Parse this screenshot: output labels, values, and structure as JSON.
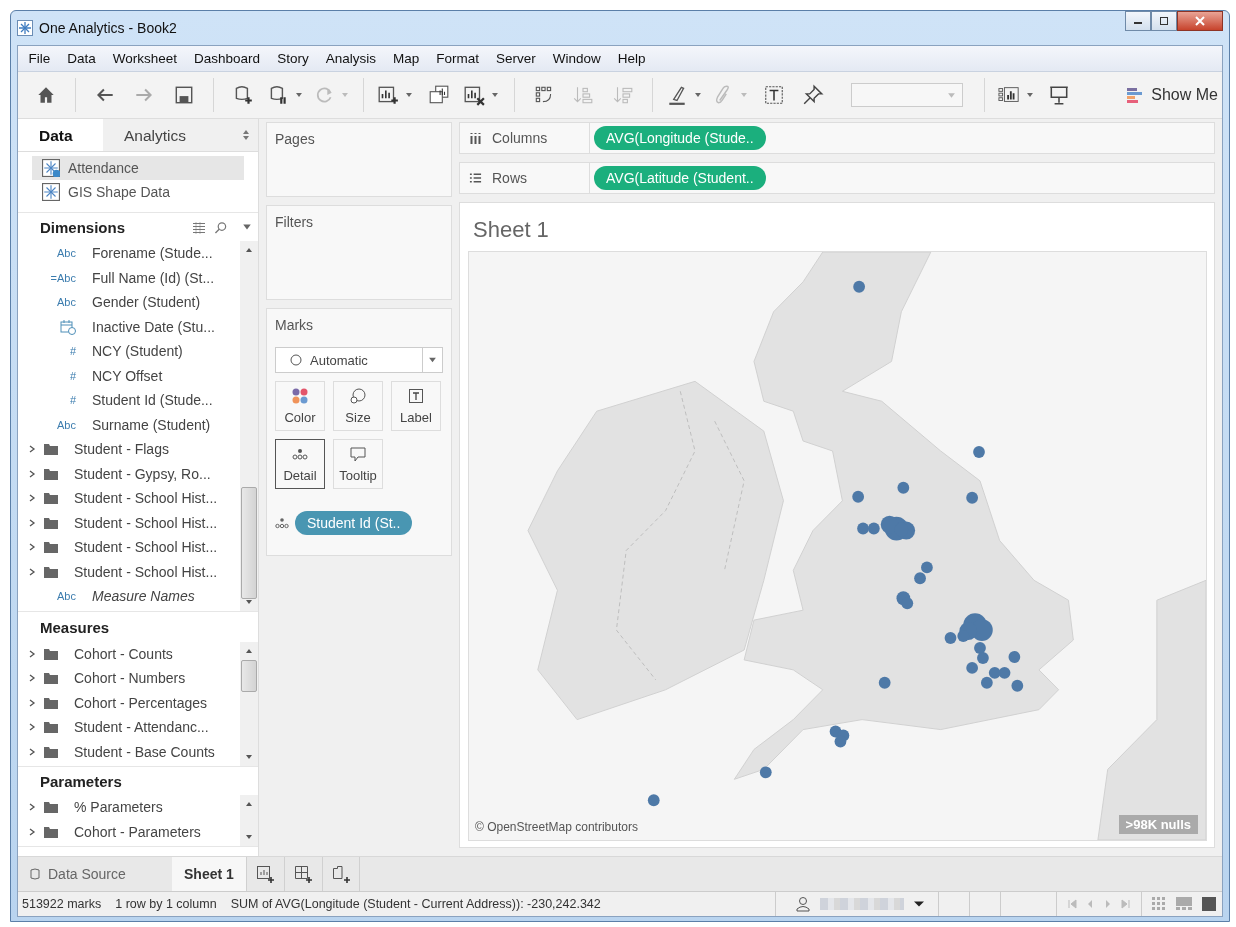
{
  "window": {
    "title": "One Analytics - Book2"
  },
  "menu": [
    "File",
    "Data",
    "Worksheet",
    "Dashboard",
    "Story",
    "Analysis",
    "Map",
    "Format",
    "Server",
    "Window",
    "Help"
  ],
  "toolbar": {
    "show_me": "Show Me"
  },
  "side_tabs": [
    {
      "label": "Data",
      "selected": true
    },
    {
      "label": "Analytics",
      "selected": false
    }
  ],
  "data_sources": [
    {
      "name": "Attendance",
      "selected": true
    },
    {
      "name": "GIS Shape Data",
      "selected": false
    }
  ],
  "dimensions": {
    "title": "Dimensions",
    "items": [
      {
        "kind": "field",
        "type": "Abc",
        "name": "Forename (Stude...",
        "italic": false
      },
      {
        "kind": "field",
        "type": "=Abc",
        "name": "Full Name (Id) (St...",
        "italic": false
      },
      {
        "kind": "field",
        "type": "Abc",
        "name": "Gender (Student)",
        "italic": false
      },
      {
        "kind": "date",
        "name": "Inactive Date (Stu...",
        "italic": false
      },
      {
        "kind": "field",
        "type": "#",
        "name": "NCY (Student)",
        "italic": false
      },
      {
        "kind": "field",
        "type": "#",
        "name": "NCY Offset",
        "italic": false
      },
      {
        "kind": "field",
        "type": "#",
        "name": "Student Id (Stude...",
        "italic": false
      },
      {
        "kind": "field",
        "type": "Abc",
        "name": "Surname (Student)",
        "italic": false
      },
      {
        "kind": "folder",
        "name": "Student - Flags",
        "expanded": false
      },
      {
        "kind": "folder",
        "name": "Student - Gypsy, Ro...",
        "expanded": false
      },
      {
        "kind": "folder",
        "name": "Student - School Hist...",
        "expanded": false
      },
      {
        "kind": "folder",
        "name": "Student - School Hist...",
        "expanded": false
      },
      {
        "kind": "folder",
        "name": "Student - School Hist...",
        "expanded": false
      },
      {
        "kind": "folder",
        "name": "Student - School Hist...",
        "expanded": false
      },
      {
        "kind": "field",
        "type": "Abc",
        "name": "Measure Names",
        "italic": true
      }
    ]
  },
  "measures": {
    "title": "Measures",
    "items": [
      {
        "kind": "folder",
        "name": "Cohort - Counts",
        "expanded": false
      },
      {
        "kind": "folder",
        "name": "Cohort - Numbers",
        "expanded": false
      },
      {
        "kind": "folder",
        "name": "Cohort - Percentages",
        "expanded": false
      },
      {
        "kind": "folder",
        "name": "Student - Attendanc...",
        "expanded": false
      },
      {
        "kind": "folder",
        "name": "Student - Base Counts",
        "expanded": false
      }
    ]
  },
  "parameters": {
    "title": "Parameters",
    "items": [
      {
        "kind": "folder",
        "name": "% Parameters",
        "expanded": false
      },
      {
        "kind": "folder",
        "name": "Cohort - Parameters",
        "expanded": false
      }
    ]
  },
  "shelves": {
    "pages": "Pages",
    "filters": "Filters",
    "columns": {
      "label": "Columns",
      "pills": [
        "AVG(Longitude (Stude.."
      ]
    },
    "rows": {
      "label": "Rows",
      "pills": [
        "AVG(Latitude (Student.."
      ]
    }
  },
  "marks": {
    "title": "Marks",
    "mark_type": "Automatic",
    "cards": [
      {
        "label": "Color",
        "kind": "color",
        "selected": false
      },
      {
        "label": "Size",
        "kind": "size",
        "selected": false
      },
      {
        "label": "Label",
        "kind": "label",
        "selected": false
      },
      {
        "label": "Detail",
        "kind": "detail",
        "selected": true
      },
      {
        "label": "Tooltip",
        "kind": "tooltip",
        "selected": false
      }
    ],
    "pills": [
      {
        "label": "Student Id (St..",
        "kind": "detail"
      }
    ]
  },
  "sheet": {
    "title": "Sheet 1",
    "attribution": "© OpenStreetMap contributors",
    "nulls": ">98K nulls"
  },
  "sheet_tabs": [
    {
      "label": "Data Source",
      "kind": "data_source",
      "selected": false
    },
    {
      "label": "Sheet 1",
      "kind": "sheet",
      "selected": true
    }
  ],
  "status": {
    "marks": "513922 marks",
    "grid": "1 row by 1 column",
    "summary": "SUM of AVG(Longitude (Student - Current Address)): -230,242.342"
  }
}
